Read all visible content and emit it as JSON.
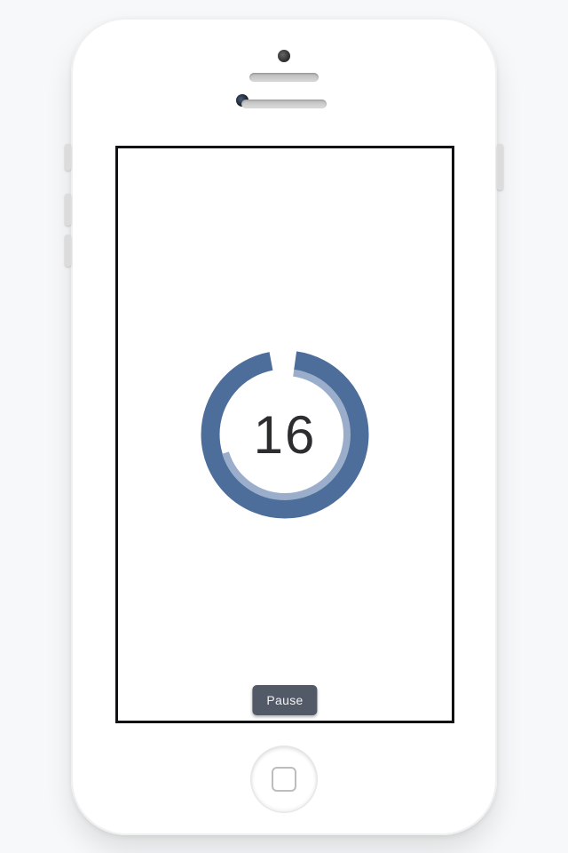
{
  "timer": {
    "seconds_remaining": "16",
    "outer_fraction": 0.97,
    "inner_fraction": 0.68,
    "color_outer": "#4d6d9a",
    "color_inner": "#9aaecb",
    "gap_deg": 8
  },
  "controls": {
    "pause_label": "Pause"
  }
}
